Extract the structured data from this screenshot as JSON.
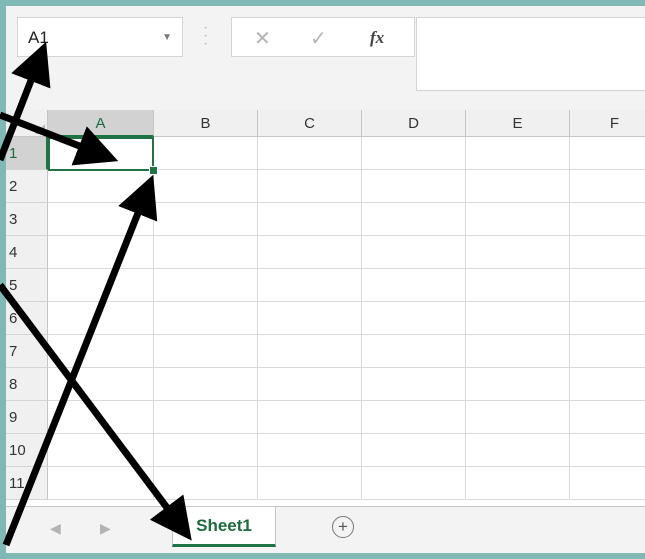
{
  "formula_bar": {
    "name_box_value": "A1",
    "cancel_icon": "✕",
    "enter_icon": "✓",
    "fx_label": "fx",
    "formula_value": ""
  },
  "columns": [
    "A",
    "B",
    "C",
    "D",
    "E",
    "F"
  ],
  "rows": [
    "1",
    "2",
    "3",
    "4",
    "5",
    "6",
    "7",
    "8",
    "9",
    "10",
    "11"
  ],
  "selected_cell": "A1",
  "sheets": [
    {
      "name": "Sheet1",
      "active": true
    }
  ],
  "add_sheet_icon": "+",
  "accent_color": "#217346",
  "arrow_color": "#000000"
}
